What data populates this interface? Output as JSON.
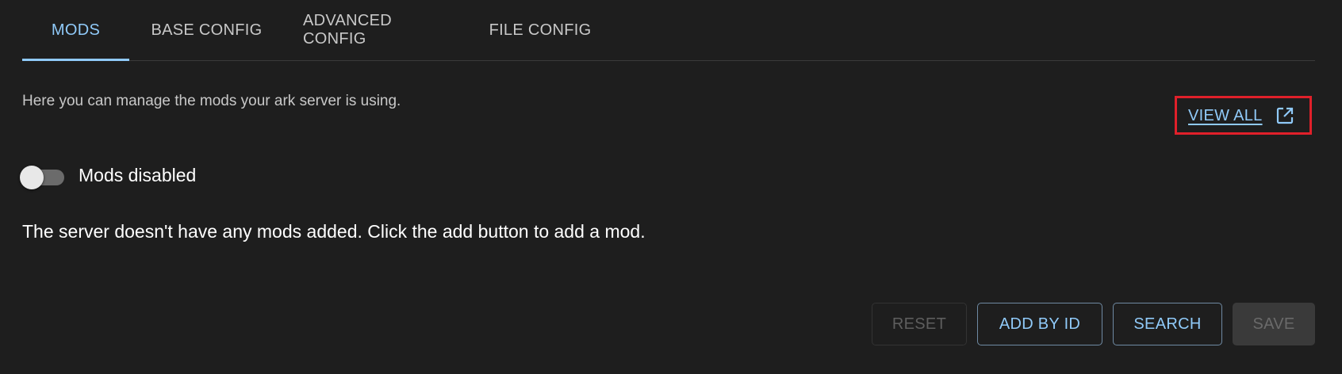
{
  "tabs": [
    {
      "label": "MODS",
      "active": true
    },
    {
      "label": "BASE CONFIG",
      "active": false
    },
    {
      "label": "ADVANCED CONFIG",
      "active": false
    },
    {
      "label": "FILE CONFIG",
      "active": false
    }
  ],
  "description": "Here you can manage the mods your ark server is using.",
  "view_all": {
    "label": "VIEW ALL",
    "icon": "external-link-icon"
  },
  "mods_toggle": {
    "label": "Mods disabled",
    "enabled": false
  },
  "empty_message": "The server doesn't have any mods added. Click the add button to add a mod.",
  "buttons": {
    "reset": "RESET",
    "add_by_id": "ADD BY ID",
    "search": "SEARCH",
    "save": "SAVE"
  },
  "colors": {
    "background": "#1e1e1e",
    "accent": "#90caf9",
    "highlight_frame": "#e0202a"
  }
}
